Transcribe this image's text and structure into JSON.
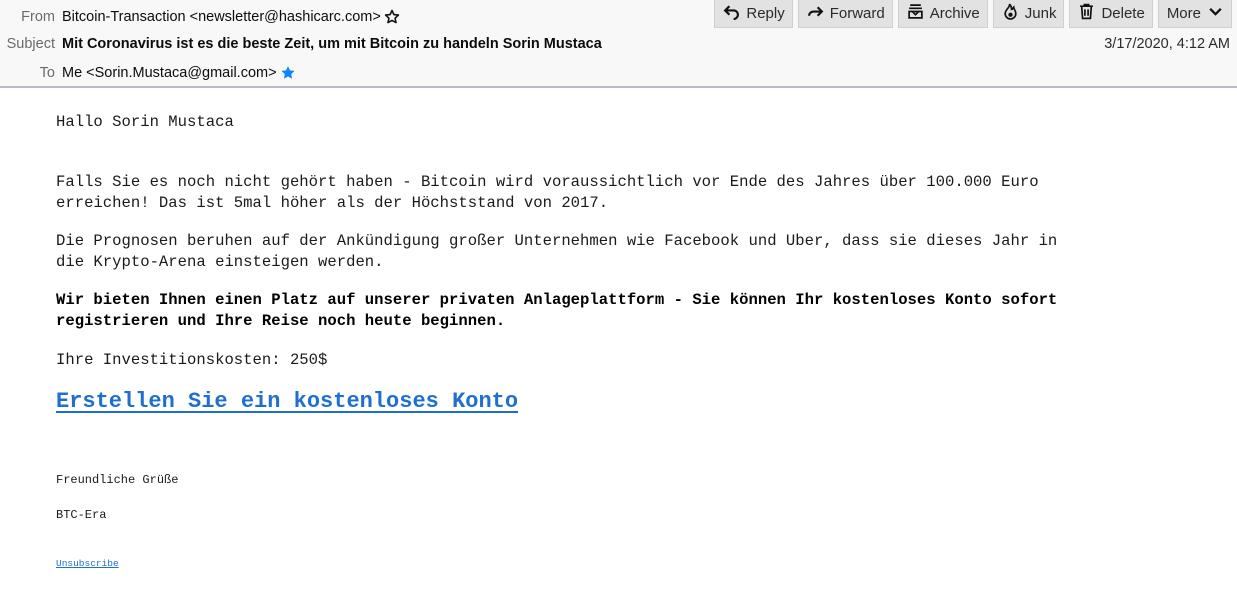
{
  "header": {
    "from_label": "From",
    "from_value": "Bitcoin-Transaction <newsletter@hashicarc.com>",
    "subject_label": "Subject",
    "subject_value": "Mit Coronavirus ist es die beste Zeit, um mit Bitcoin zu handeln Sorin Mustaca",
    "to_label": "To",
    "to_value": "Me <Sorin.Mustaca@gmail.com>",
    "date": "3/17/2020, 4:12 AM",
    "from_star_icon": "star-outline-icon",
    "to_star_icon": "star-filled-icon",
    "to_star_color": "#0a84ff"
  },
  "toolbar": {
    "buttons": [
      {
        "label": "Reply",
        "icon": "reply-icon"
      },
      {
        "label": "Forward",
        "icon": "forward-icon"
      },
      {
        "label": "Archive",
        "icon": "archive-icon"
      },
      {
        "label": "Junk",
        "icon": "junk-icon"
      },
      {
        "label": "Delete",
        "icon": "trash-icon"
      },
      {
        "label": "More",
        "icon": "chevron-down-icon"
      }
    ]
  },
  "message": {
    "greeting": "Hallo Sorin Mustaca",
    "paragraph1": "Falls Sie es noch nicht gehört haben - Bitcoin wird voraussichtlich vor Ende des Jahres über 100.000 Euro\nerreichen! Das ist 5mal höher als der Höchststand von 2017.",
    "paragraph2": "Die Prognosen beruhen auf der Ankündigung großer Unternehmen wie Facebook und Uber, dass sie dieses Jahr in\ndie Krypto-Arena einsteigen werden.",
    "paragraph3": "Wir bieten Ihnen einen Platz auf unserer privaten Anlageplattform - Sie können Ihr kostenloses Konto sofort\nregistrieren und Ihre Reise noch heute beginnen.",
    "investment": "Ihre Investitionskosten: 250$",
    "cta_link": "Erstellen Sie ein kostenloses Konto",
    "closing": "Freundliche Grüße",
    "signature": "BTC-Era",
    "unsubscribe": "Unsubscribe",
    "link_color": "#1f6fd1"
  }
}
